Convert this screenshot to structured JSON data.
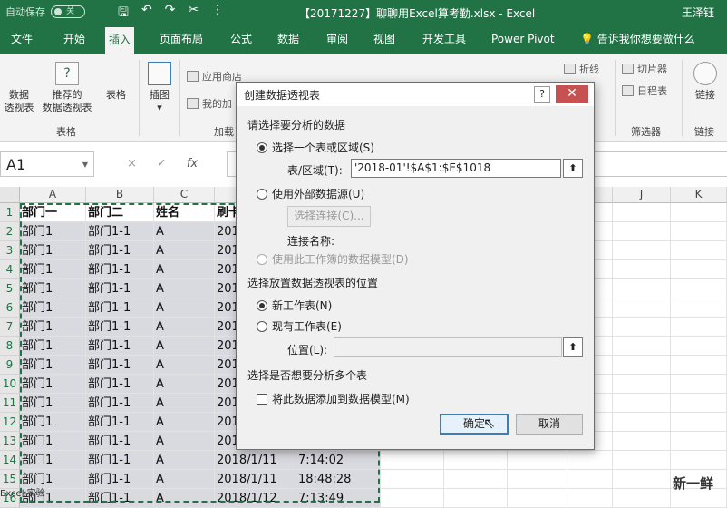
{
  "titlebar": {
    "autosave_label": "自动保存",
    "autosave_state": "关",
    "doc_title": "【20171227】聊聊用Excel算考勤.xlsx  -  Excel",
    "user": "王泽钰"
  },
  "tabs": [
    "文件",
    "开始",
    "插入",
    "页面布局",
    "公式",
    "数据",
    "审阅",
    "视图",
    "开发工具",
    "Power Pivot",
    "告诉我你想要做什么"
  ],
  "ribbon": {
    "pivot_label": "数据\n透视表",
    "pivot_label_1": "数据",
    "pivot_label_2": "透视表",
    "recommended_label_1": "推荐的",
    "recommended_label_2": "数据透视表",
    "table_label": "表格",
    "tables_group": "表格",
    "illustrations_label": "插图",
    "store_label": "应用商店",
    "myaddins_label": "我的加",
    "addins_group": "加载",
    "sparkline_line": "折线",
    "slicer_label": "切片器",
    "timeline_label": "日程表",
    "filter_group": "筛选器",
    "link_label": "链接",
    "link_group": "链接"
  },
  "formula_bar": {
    "name_box": "A1",
    "cancel_icon": "×",
    "enter_icon": "✓",
    "fx": "fx"
  },
  "grid": {
    "columns": [
      "A",
      "B",
      "C",
      "D",
      "E",
      "F",
      "G",
      "H",
      "I",
      "J",
      "K"
    ],
    "rows": [
      {
        "n": "1",
        "a": "部门一",
        "b": "部门二",
        "c": "姓名",
        "d": "刷卡",
        "e": ""
      },
      {
        "n": "2",
        "a": "部门1",
        "b": "部门1-1",
        "c": "A",
        "d": "201",
        "e": ""
      },
      {
        "n": "3",
        "a": "部门1",
        "b": "部门1-1",
        "c": "A",
        "d": "201",
        "e": ""
      },
      {
        "n": "4",
        "a": "部门1",
        "b": "部门1-1",
        "c": "A",
        "d": "201",
        "e": ""
      },
      {
        "n": "5",
        "a": "部门1",
        "b": "部门1-1",
        "c": "A",
        "d": "201",
        "e": ""
      },
      {
        "n": "6",
        "a": "部门1",
        "b": "部门1-1",
        "c": "A",
        "d": "201",
        "e": ""
      },
      {
        "n": "7",
        "a": "部门1",
        "b": "部门1-1",
        "c": "A",
        "d": "201",
        "e": ""
      },
      {
        "n": "8",
        "a": "部门1",
        "b": "部门1-1",
        "c": "A",
        "d": "201",
        "e": ""
      },
      {
        "n": "9",
        "a": "部门1",
        "b": "部门1-1",
        "c": "A",
        "d": "201",
        "e": ""
      },
      {
        "n": "10",
        "a": "部门1",
        "b": "部门1-1",
        "c": "A",
        "d": "201",
        "e": ""
      },
      {
        "n": "11",
        "a": "部门1",
        "b": "部门1-1",
        "c": "A",
        "d": "201",
        "e": ""
      },
      {
        "n": "12",
        "a": "部门1",
        "b": "部门1-1",
        "c": "A",
        "d": "201",
        "e": ""
      },
      {
        "n": "13",
        "a": "部门1",
        "b": "部门1-1",
        "c": "A",
        "d": "201",
        "e": ""
      },
      {
        "n": "14",
        "a": "部门1",
        "b": "部门1-1",
        "c": "A",
        "d": "2018/1/11",
        "e": "7:14:02"
      },
      {
        "n": "15",
        "a": "部门1",
        "b": "部门1-1",
        "c": "A",
        "d": "2018/1/11",
        "e": "18:48:28"
      },
      {
        "n": "16",
        "a": "部门1",
        "b": "部门1-1",
        "c": "A",
        "d": "2018/1/12",
        "e": "7:13:49"
      }
    ],
    "status": "Excel 实验",
    "watermark": "新一鲜"
  },
  "dialog": {
    "title": "创建数据透视表",
    "help": "?",
    "close": "✕",
    "section1": "请选择要分析的数据",
    "opt_range": "选择一个表或区域(S)",
    "range_label": "表/区域(T):",
    "range_value": "'2018-01'!$A$1:$E$1018",
    "opt_external": "使用外部数据源(U)",
    "choose_conn": "选择连接(C)...",
    "conn_name": "连接名称:",
    "opt_datamodel": "使用此工作簿的数据模型(D)",
    "section2": "选择放置数据透视表的位置",
    "opt_new": "新工作表(N)",
    "opt_existing": "现有工作表(E)",
    "location_label": "位置(L):",
    "location_value": "",
    "section3": "选择是否想要分析多个表",
    "add_model": "将此数据添加到数据模型(M)",
    "ok": "确定",
    "cancel": "取消"
  }
}
